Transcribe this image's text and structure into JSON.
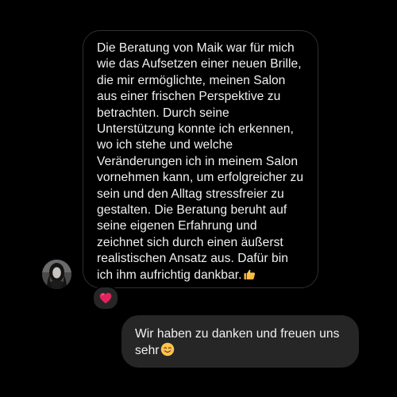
{
  "conversation": {
    "incoming": {
      "text": "Die Beratung von Maik war für mich wie das Aufsetzen einer neuen Brille, die mir ermöglichte, meinen Salon aus einer frischen Perspektive zu betrachten. Durch seine Unterstützung konnte ich erkennen, wo ich stehe und welche Veränderungen ich in meinem Salon vornehmen kann, um erfolgreicher zu sein und den Alltag stressfreier zu gestalten. Die Beratung beruht auf seine eigenen Erfahrung und zeichnet sich durch einen äußerst realistischen Ansatz aus. Dafür bin ich ihm aufrichtig dankbar.",
      "trailing_emoji": "thumbs-up-icon",
      "reaction": "red-heart-icon",
      "sender_avatar": "avatar"
    },
    "outgoing": {
      "text": "Wir haben zu danken und freuen uns sehr",
      "trailing_emoji": "smiling-face-icon"
    }
  },
  "colors": {
    "background": "#000000",
    "incoming_border": "#2f2f2f",
    "outgoing_bubble": "#262626",
    "text": "#f2f2f2",
    "heart": "#e0245e"
  }
}
